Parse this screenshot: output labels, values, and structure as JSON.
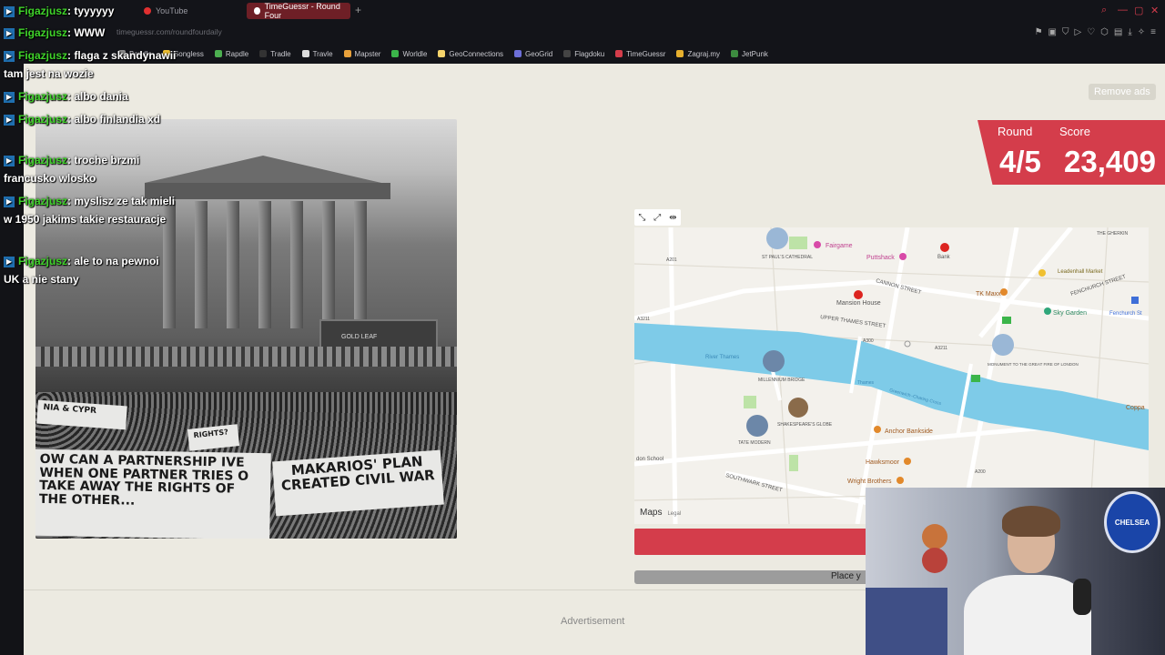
{
  "browser": {
    "tabs": [
      {
        "label": "YouTube",
        "active": false
      },
      {
        "label": "TimeGuessr - Round Four",
        "active": true
      }
    ],
    "new_tab": "+",
    "url": "timeguessr.com/roundfourdaily"
  },
  "bookmarks": [
    {
      "label": "Bandle",
      "color": "#8a8a8a"
    },
    {
      "label": "Songless",
      "color": "#f0c030"
    },
    {
      "label": "Rapdle",
      "color": "#4caf50"
    },
    {
      "label": "Tradle",
      "color": "#333333"
    },
    {
      "label": "Travle",
      "color": "#dddddd"
    },
    {
      "label": "Mapster",
      "color": "#e8a13b"
    },
    {
      "label": "Worldle",
      "color": "#3bb54a"
    },
    {
      "label": "GeoConnections",
      "color": "#f5d36b"
    },
    {
      "label": "GeoGrid",
      "color": "#6d6fd8"
    },
    {
      "label": "Flagdoku",
      "color": "#444444"
    },
    {
      "label": "TimeGuessr",
      "color": "#d43d4b"
    },
    {
      "label": "Zagraj.my",
      "color": "#e6b02e"
    },
    {
      "label": "JetPunk",
      "color": "#3d8c40"
    }
  ],
  "chat": [
    {
      "user": "Figazjusz",
      "text": ": tyyyyyy"
    },
    {
      "user": "Figazjusz",
      "text": ": WWW"
    },
    {
      "user": "Figazjusz",
      "text": ": flaga z skandynawii tam jest na wozie"
    },
    {
      "user": "Figazjusz",
      "text": ": albo dania"
    },
    {
      "user": "Figazjusz",
      "text": ": albo finlandia xd"
    },
    {
      "user": "Figazjusz",
      "text": ": troche brzmi francusko wlosko"
    },
    {
      "user": "Figazjusz",
      "text": ": myslisz ze tak mieli w 1950 jakims takie restauracje"
    },
    {
      "user": "Figazjusz",
      "text": ": ale to na pewnoi UK a nie stany"
    }
  ],
  "remove_ads": "Remove ads",
  "round": {
    "label": "Round",
    "value": "4/5"
  },
  "score": {
    "label": "Score",
    "value": "23,409"
  },
  "photo_signs": {
    "sign1": "OW CAN A PARTNERSHIP IVE WHEN ONE PARTNER TRIES O TAKE AWAY THE RIGHTS OF THE OTHER...",
    "sign2": "MAKARIOS' PLAN CREATED CIVIL WAR",
    "sign3": "NIA & CYPR",
    "sign4": "RIGHTS?",
    "bus_sign": "GOLD LEAF"
  },
  "map": {
    "labels": {
      "fairgame": "Fairgame",
      "stpauls": "ST PAUL'S CATHEDRAL",
      "puttshack": "Puttshack",
      "bank": "Bank",
      "leadenhall": "Leadenhall Market",
      "fenchurch_st": "FENCHURCH STREET",
      "cannon": "CANNON STREET",
      "tkmaxx": "TK Maxx",
      "mansion": "Mansion House",
      "skygarden": "Sky Garden",
      "fenchurch_station": "Fenchurch St",
      "upper_thames": "UPPER THAMES STREET",
      "a300": "A300",
      "a3211_left": "A3211",
      "a3211_right": "A3211",
      "a201": "A201",
      "river": "River Thames",
      "millennium": "MILLENNIUM BRIDGE",
      "monument": "MONUMENT TO THE GREAT FIRE OF LONDON",
      "greenwich": "Greenwich–Charing Cross",
      "thames": "Thames",
      "shakespeare": "SHAKESPEARE'S GLOBE",
      "tate": "TATE MODERN",
      "anchor": "Anchor Bankside",
      "hawksmoor": "Hawksmoor",
      "wright": "Wright Brothers",
      "southwark": "SOUTHWARK STREET",
      "a200": "A200",
      "coppa": "Coppa",
      "gherkin": "THE GHERKIN",
      "school": "don School"
    },
    "attribution": "Maps",
    "legal": "Legal"
  },
  "guess_button": "",
  "progress": {
    "text": "Place y",
    "fill": 1.0
  },
  "advertisement": "Advertisement",
  "webcam": {
    "badge": "CHELSEA"
  },
  "colors": {
    "accent": "#d43d4b",
    "river": "#7ecbe8",
    "chat_user": "#3fd32a"
  }
}
